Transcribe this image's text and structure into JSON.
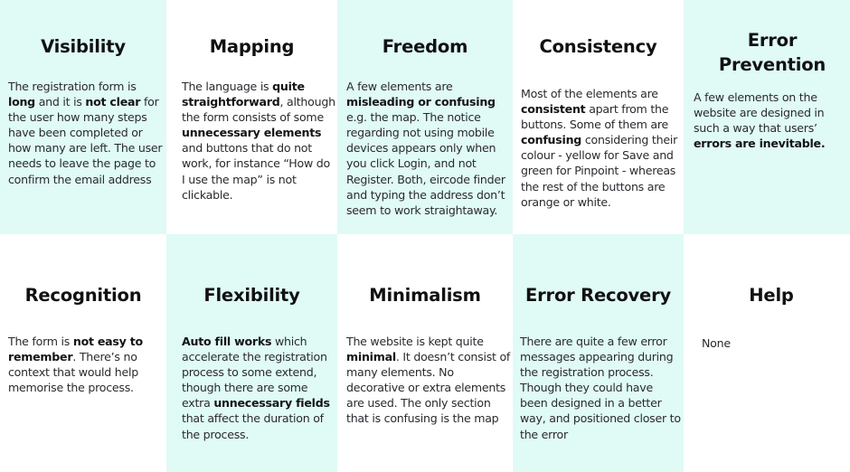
{
  "colors": {
    "mint": "#e0faf6",
    "white": "#ffffff",
    "text": "#1e1e24",
    "heading": "#111111"
  },
  "cells": [
    {
      "title": "Visibility",
      "body": [
        {
          "t": "The registration form is "
        },
        {
          "t": "long",
          "b": true
        },
        {
          "t": " and it is "
        },
        {
          "t": "not clear",
          "b": true
        },
        {
          "t": " for the user how many steps have been completed or how many are left. The user needs to leave the page to confirm the email address"
        }
      ]
    },
    {
      "title": "Mapping",
      "body": [
        {
          "t": "The language is "
        },
        {
          "t": "quite straightforward",
          "b": true
        },
        {
          "t": ", although the form consists of some "
        },
        {
          "t": "unnecessary elements",
          "b": true
        },
        {
          "t": " and buttons that do not work, for instance “How do I use the map” is not clickable."
        }
      ]
    },
    {
      "title": "Freedom",
      "body": [
        {
          "t": "A few elements are "
        },
        {
          "t": "misleading or confusing",
          "b": true
        },
        {
          "t": " e.g. the map. The notice regarding not using mobile devices appears only when you click Login, and not Register. Both, eircode finder and typing the address don’t seem to work straightaway."
        }
      ]
    },
    {
      "title": "Consistency",
      "body": [
        {
          "t": "Most of the elements are "
        },
        {
          "t": "consistent",
          "b": true
        },
        {
          "t": " apart from the buttons. Some of them are "
        },
        {
          "t": "confusing",
          "b": true
        },
        {
          "t": " considering their colour - yellow for Save and green for Pinpoint - whereas the rest of the buttons are orange or white."
        }
      ]
    },
    {
      "title": "Error Prevention",
      "body": [
        {
          "t": "A few elements on the website are designed in such a way that users’ "
        },
        {
          "t": "errors are inevitable.",
          "b": true
        }
      ]
    },
    {
      "title": "Recognition",
      "body": [
        {
          "t": "The form is "
        },
        {
          "t": "not easy to remember",
          "b": true
        },
        {
          "t": ". There’s no context that would help memorise the process."
        }
      ]
    },
    {
      "title": "Flexibility",
      "body": [
        {
          "t": "Auto fill works",
          "b": true
        },
        {
          "t": " which accelerate the registration process to some extend, though there are some extra "
        },
        {
          "t": "unnecessary fields",
          "b": true
        },
        {
          "t": " that affect the duration of the process."
        }
      ]
    },
    {
      "title": "Minimalism",
      "body": [
        {
          "t": "The website is kept quite "
        },
        {
          "t": "minimal",
          "b": true
        },
        {
          "t": ". It doesn’t consist of many elements. No decorative or extra elements are used. The only section that is confusing is the map"
        }
      ]
    },
    {
      "title": "Error Recovery",
      "body": [
        {
          "t": "There are quite a few error messages appearing during the registration process. Though they could have been designed in a better way, and positioned closer to the error"
        }
      ]
    },
    {
      "title": "Help",
      "body": [
        {
          "t": "None"
        }
      ]
    }
  ]
}
